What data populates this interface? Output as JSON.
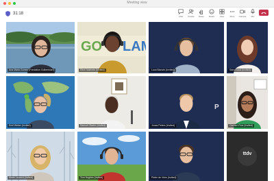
{
  "window": {
    "title": "Meeting view"
  },
  "toolbar": {
    "timer": "31:18",
    "buttons": [
      {
        "label": "Chat",
        "icon": "chat-icon"
      },
      {
        "label": "People",
        "icon": "people-icon"
      },
      {
        "label": "Raise",
        "icon": "raise-hand-icon"
      },
      {
        "label": "React",
        "icon": "react-icon"
      },
      {
        "label": "View",
        "icon": "view-icon"
      },
      {
        "label": "More",
        "icon": "more-icon"
      },
      {
        "label": "Camera",
        "icon": "camera-icon"
      },
      {
        "label": "Mic",
        "icon": "mic-icon"
      }
    ],
    "leave_icon": "phone-hangup-icon"
  },
  "participants": [
    {
      "name": "Ana Maria Gomez (Fondation Gulbenkian)",
      "background": "lake-landscape"
    },
    {
      "name": "Ethel Ndebele (Invited)",
      "background": "go-climate-banner"
    },
    {
      "name": "Luca Bianchi (Invited)",
      "background": "navy"
    },
    {
      "name": "Sara Rossi (Invited)",
      "background": "navy"
    },
    {
      "name": "Emil Weber (Invited)",
      "background": "world-map"
    },
    {
      "name": "Samuel Okafor (Invited)",
      "background": "office-wall"
    },
    {
      "name": "Jonas Peters (Invited)",
      "background": "navy-logo"
    },
    {
      "name": "Carmen Ruiz (Invited)",
      "background": "office-room"
    },
    {
      "name": "Marie Laurent (Invited)",
      "background": "winter-trees"
    },
    {
      "name": "Tom Hughes (Invited)",
      "background": "sky-field"
    },
    {
      "name": "Pieter de Vries (Invited)",
      "background": "navy"
    },
    {
      "name": "ttdv",
      "background": "dark-logo"
    }
  ],
  "colors": {
    "leave": "#c4314b",
    "tile_navy": "#1d2b4f"
  }
}
